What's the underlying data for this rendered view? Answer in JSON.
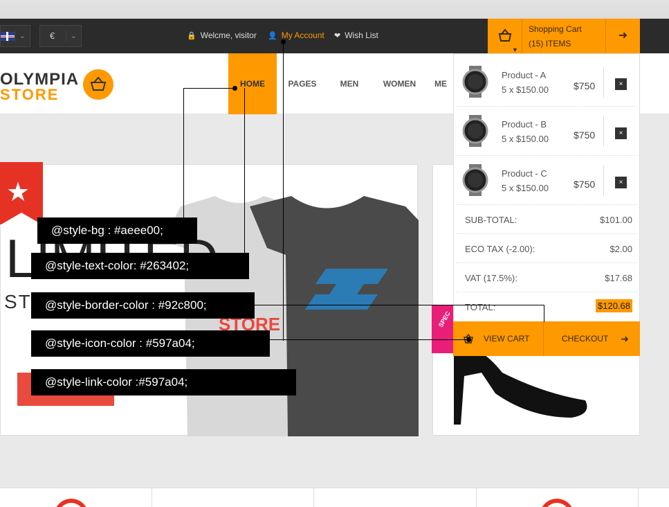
{
  "topbar": {
    "currency_symbol": "€",
    "welcome": "Welcme, visitor",
    "my_account": "My Account",
    "wish_list": "Wish List",
    "icons": {
      "lock": "lock-icon",
      "user": "user-icon",
      "heart": "heart-icon"
    }
  },
  "cart": {
    "title": "Shopping Cart",
    "items_count": "(15) ITEMS",
    "products": [
      {
        "name": "Product - A",
        "qty": "5 x $150.00",
        "price": "$750"
      },
      {
        "name": "Product - B",
        "qty": "5 x $150.00",
        "price": "$750"
      },
      {
        "name": "Product - C",
        "qty": "5 x $150.00",
        "price": "$750"
      }
    ],
    "totals": [
      {
        "label": "SUB-TOTAL:",
        "value": "$101.00"
      },
      {
        "label": "ECO TAX (-2.00):",
        "value": "$2.00"
      },
      {
        "label": "VAT (17.5%):",
        "value": "$17.68"
      },
      {
        "label": "TOTAL:",
        "value": "$120.68"
      }
    ],
    "view_cart": "VIEW CART",
    "checkout": "CHECKOUT",
    "remove_symbol": "×"
  },
  "logo": {
    "line1": "OLYMPIA",
    "line2": "STORE"
  },
  "nav": [
    "HOME",
    "PAGES",
    "MEN",
    "WOMEN",
    "ME"
  ],
  "banner": {
    "big_text": "LIMITED",
    "sub_text": "STO",
    "logo_letter": "S",
    "tag_text": "STORE",
    "side_badge": "SPEC"
  },
  "annotations": [
    "@style-bg : #aeee00;",
    "@style-text-color: #263402;",
    "@style-border-color : #92c800;",
    "@style-icon-color : #597a04;",
    "@style-link-color :#597a04;"
  ],
  "colors": {
    "accent": "#ff9900",
    "topbar": "#2b2b2b",
    "red": "#e84a3e",
    "pink": "#e91e7a"
  }
}
